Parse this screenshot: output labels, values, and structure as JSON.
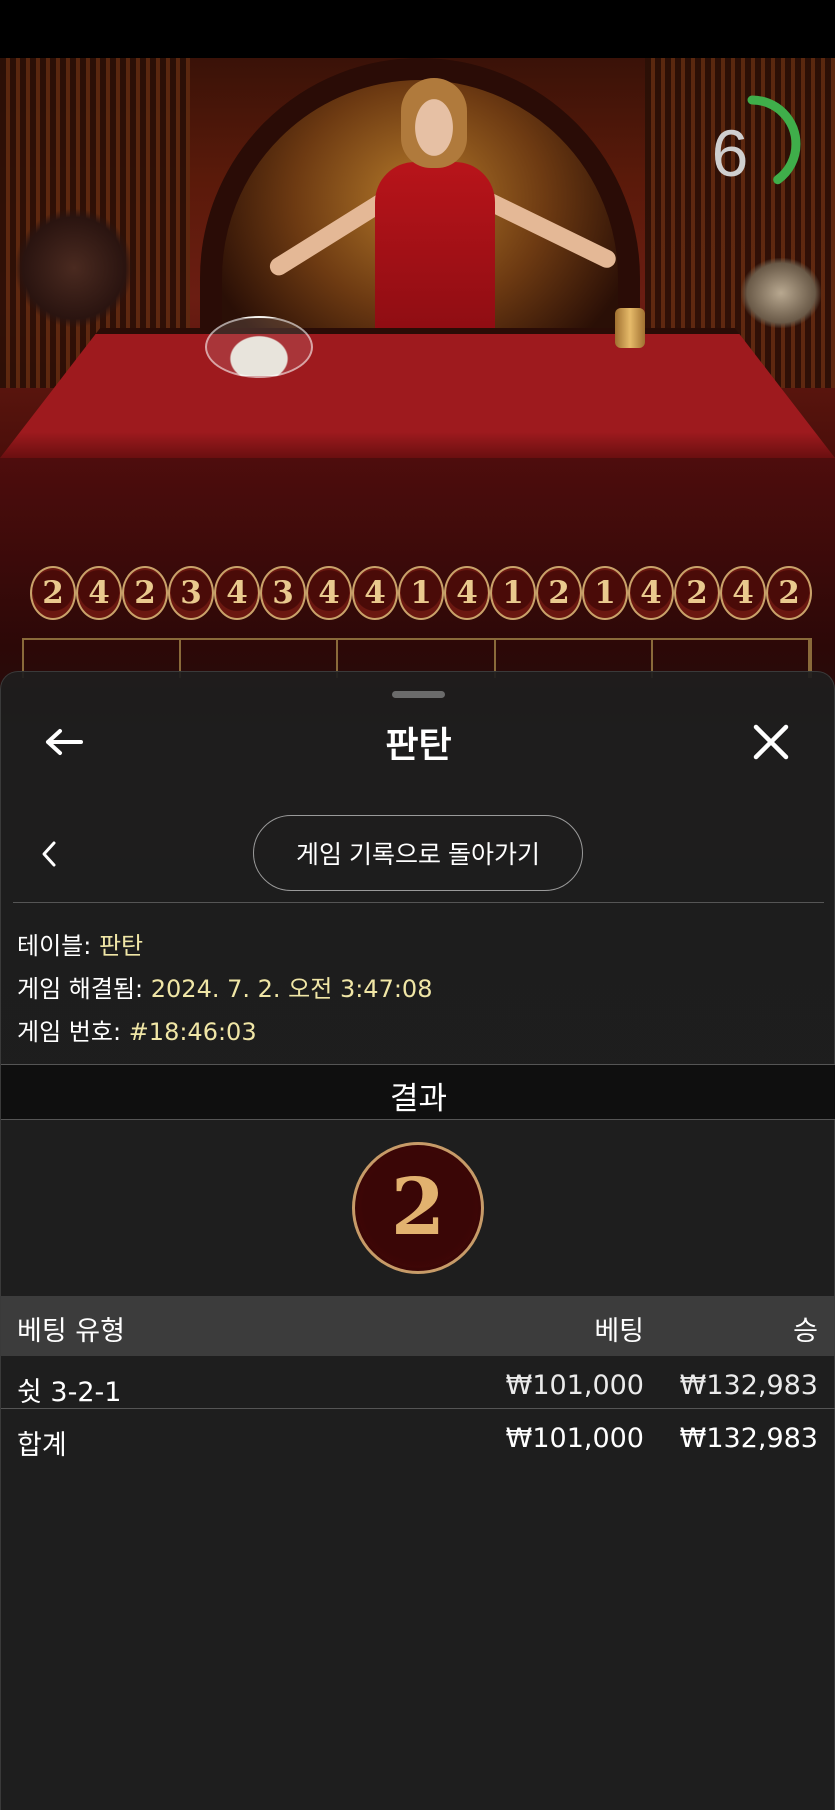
{
  "video": {
    "countdown": "6",
    "countdown_fraction": 0.4
  },
  "history": {
    "results": [
      "2",
      "4",
      "2",
      "3",
      "4",
      "3",
      "4",
      "4",
      "1",
      "4",
      "1",
      "2",
      "1",
      "4",
      "2",
      "4",
      "2"
    ]
  },
  "sheet": {
    "title": "판탄",
    "back_to_history_label": "게임 기록으로 돌아가기",
    "info": {
      "table_label": "테이블:",
      "table_value": "판탄",
      "resolved_label": "게임 해결됨:",
      "resolved_value": "2024. 7. 2. 오전 3:47:08",
      "game_no_label": "게임 번호:",
      "game_no_value": "#18:46:03"
    },
    "result_label": "결과",
    "result_value": "2",
    "table": {
      "headers": {
        "bet_type": "베팅 유형",
        "bet": "베팅",
        "win": "승"
      },
      "rows": [
        {
          "bet_type": "쉿 3-2-1",
          "bet": "₩101,000",
          "win": "₩132,983"
        }
      ],
      "total": {
        "label": "합계",
        "bet": "₩101,000",
        "win": "₩132,983"
      }
    }
  },
  "colors": {
    "accent_gold": "#e2b26f",
    "info_value": "#f0e6a6",
    "timer_green": "#3fae4a"
  }
}
